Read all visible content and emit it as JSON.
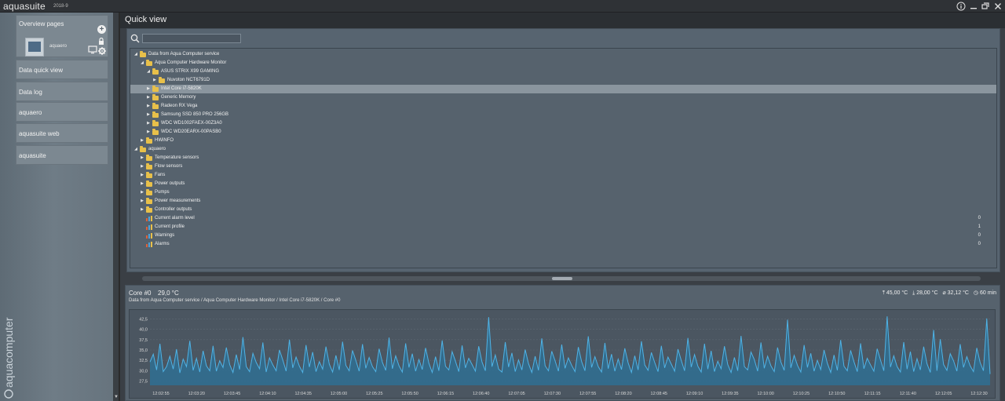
{
  "app": {
    "name": "aquasuite",
    "version": "2018-9",
    "brand_vertical": "aquacomputer",
    "window_controls": [
      "info-icon",
      "minimize-icon",
      "restore-icon",
      "close-icon"
    ]
  },
  "sidebar": {
    "overview": {
      "label": "Overview pages",
      "page_label": "aquaero"
    },
    "items": [
      {
        "label": "Data quick view"
      },
      {
        "label": "Data log"
      },
      {
        "label": "aquaero"
      },
      {
        "label": "aquasuite web"
      },
      {
        "label": "aquasuite"
      }
    ]
  },
  "main": {
    "title": "Quick view",
    "search": {
      "value": "",
      "placeholder": ""
    },
    "tree": [
      {
        "label": "Data from Aqua Computer service",
        "level": 0,
        "expanded": true,
        "icon": "folder"
      },
      {
        "label": "Aqua Computer Hardware Monitor",
        "level": 1,
        "expanded": true,
        "icon": "folder"
      },
      {
        "label": "ASUS STRIX X99 GAMING",
        "level": 2,
        "expanded": true,
        "icon": "folder"
      },
      {
        "label": "Nuvoton NCT6791D",
        "level": 3,
        "expanded": false,
        "icon": "folder"
      },
      {
        "label": "Intel Core i7-5820K",
        "level": 2,
        "expanded": false,
        "icon": "folder",
        "selected": true
      },
      {
        "label": "Generic Memory",
        "level": 2,
        "expanded": false,
        "icon": "folder"
      },
      {
        "label": "Radeon RX Vega",
        "level": 2,
        "expanded": false,
        "icon": "folder"
      },
      {
        "label": "Samsung SSD 850 PRO 256GB",
        "level": 2,
        "expanded": false,
        "icon": "folder"
      },
      {
        "label": "WDC WD1002FAEX-00Z3A0",
        "level": 2,
        "expanded": false,
        "icon": "folder"
      },
      {
        "label": "WDC WD20EARX-00PASB0",
        "level": 2,
        "expanded": false,
        "icon": "folder"
      },
      {
        "label": "HWiNFO",
        "level": 1,
        "expanded": false,
        "icon": "folder"
      },
      {
        "label": "aquaero",
        "level": 0,
        "expanded": true,
        "icon": "folder"
      },
      {
        "label": "Temperature sensors",
        "level": 1,
        "expanded": false,
        "icon": "folder"
      },
      {
        "label": "Flow sensors",
        "level": 1,
        "expanded": false,
        "icon": "folder"
      },
      {
        "label": "Fans",
        "level": 1,
        "expanded": false,
        "icon": "folder"
      },
      {
        "label": "Power outputs",
        "level": 1,
        "expanded": false,
        "icon": "folder"
      },
      {
        "label": "Pumps",
        "level": 1,
        "expanded": false,
        "icon": "folder"
      },
      {
        "label": "Power measurements",
        "level": 1,
        "expanded": false,
        "icon": "folder"
      },
      {
        "label": "Controller outputs",
        "level": 1,
        "expanded": false,
        "icon": "folder"
      },
      {
        "label": "Current alarm level",
        "level": 1,
        "icon": "bar-chart",
        "value": "0"
      },
      {
        "label": "Current profile",
        "level": 1,
        "icon": "bar-chart",
        "value": "1"
      },
      {
        "label": "Warnings",
        "level": 1,
        "icon": "bar-chart",
        "value": "0"
      },
      {
        "label": "Alarms",
        "level": 1,
        "icon": "bar-chart",
        "value": "0"
      }
    ]
  },
  "chart_panel": {
    "sensor_name": "Core #0",
    "current_value": "29,0 °C",
    "path": "Data from Aqua Computer service / Aqua Computer Hardware Monitor / Intel Core i7-5820K / Core #0",
    "stats": {
      "max": "45,00 °C",
      "min": "28,00 °C",
      "avg": "32,12 °C",
      "range": "60 min"
    }
  },
  "colors": {
    "line": "#4fb3e6",
    "fill": "#2f6f93",
    "folder": "#e8c04a",
    "selected_row": "#8a959e"
  },
  "chart_data": {
    "type": "area",
    "title": "Core #0",
    "xlabel": "",
    "ylabel": "",
    "ylim": [
      26.5,
      43.5
    ],
    "yticks": [
      "42,5",
      "40,0",
      "37,5",
      "35,0",
      "32,5",
      "30,0",
      "27,5"
    ],
    "ytick_values": [
      42.5,
      40.0,
      37.5,
      35.0,
      32.5,
      30.0,
      27.5
    ],
    "xticks": [
      "12:02:55",
      "12:03:20",
      "12:03:45",
      "12:04:10",
      "12:04:35",
      "12:05:00",
      "12:05:25",
      "12:05:50",
      "12:06:15",
      "12:06:40",
      "12:07:05",
      "12:07:30",
      "12:07:55",
      "12:08:20",
      "12:08:45",
      "12:09:10",
      "12:09:35",
      "12:10:00",
      "12:10:25",
      "12:10:50",
      "12:11:15",
      "12:11:40",
      "12:12:05",
      "12:12:30"
    ],
    "grid": true,
    "series": [
      {
        "values": [
          32.1,
          34.0,
          30.2,
          36.5,
          29.8,
          31.0,
          33.5,
          30.4,
          35.2,
          29.5,
          32.8,
          31.0,
          37.2,
          30.1,
          33.0,
          29.7,
          34.8,
          31.2,
          30.0,
          36.0,
          29.9,
          32.4,
          30.8,
          35.6,
          31.5,
          29.6,
          33.9,
          30.3,
          38.1,
          31.0,
          29.8,
          34.2,
          32.0,
          30.5,
          36.8,
          29.7,
          33.1,
          31.4,
          30.0,
          35.0,
          32.6,
          29.9,
          37.5,
          30.7,
          33.3,
          31.1,
          29.6,
          36.2,
          30.9,
          34.5,
          29.8,
          32.2,
          30.4,
          35.8,
          31.6,
          29.7,
          33.7,
          30.2,
          37.0,
          31.3,
          30.0,
          34.9,
          32.5,
          29.9,
          36.4,
          30.6,
          33.2,
          31.0,
          29.8,
          35.3,
          32.0,
          30.1,
          38.0,
          30.5,
          33.6,
          31.2,
          29.7,
          36.6,
          30.8,
          34.1,
          29.9,
          32.7,
          30.3,
          35.5,
          31.8,
          29.6,
          33.4,
          30.0,
          37.3,
          31.1,
          30.2,
          34.6,
          32.3,
          29.8,
          36.1,
          30.7,
          33.0,
          31.5,
          29.9,
          35.9,
          32.1,
          30.0,
          42.9,
          31.0,
          33.8,
          30.4,
          29.7,
          36.9,
          30.9,
          34.3,
          29.8,
          32.6,
          30.2,
          35.1,
          31.7,
          29.6,
          33.5,
          30.1,
          37.8,
          31.2,
          30.0,
          34.7,
          32.4,
          29.9,
          36.3,
          30.6,
          33.1,
          31.3,
          29.8,
          35.7,
          32.2,
          30.0,
          38.3,
          30.8,
          33.4,
          31.0,
          29.7,
          36.7,
          30.5,
          34.0,
          29.9,
          32.8,
          30.3,
          35.4,
          31.9,
          29.6,
          33.6,
          30.2,
          37.1,
          31.4,
          30.1,
          34.4,
          32.0,
          29.8,
          36.0,
          30.7,
          33.3,
          31.6,
          29.9,
          35.2,
          32.5,
          30.0,
          37.9,
          30.9,
          33.9,
          31.1,
          29.7,
          36.5,
          30.4,
          34.8,
          29.8,
          32.3,
          30.5,
          35.9,
          31.5,
          29.6,
          33.2,
          30.0,
          38.4,
          31.0,
          30.2,
          34.5,
          32.7,
          29.9,
          36.8,
          30.6,
          33.5,
          31.2,
          29.8,
          35.6,
          32.1,
          30.1,
          42.3,
          30.7,
          33.7,
          31.3,
          29.7,
          36.2,
          30.8,
          34.2,
          29.9,
          32.5,
          30.3,
          35.0,
          31.8,
          29.6,
          33.8,
          30.1,
          37.4,
          31.1,
          30.0,
          34.9,
          32.2,
          29.8,
          36.6,
          30.5,
          33.0,
          31.4,
          29.9,
          35.3,
          32.6,
          30.0,
          43.1,
          30.9,
          33.6,
          31.0,
          29.7,
          36.9,
          30.4,
          34.6,
          29.8,
          32.9,
          30.2,
          35.8,
          31.7,
          29.6,
          39.8,
          30.0,
          37.6,
          31.5,
          30.1,
          34.1,
          32.4,
          29.9,
          36.4,
          30.8,
          33.4,
          31.2,
          29.8,
          35.5,
          32.0,
          30.0,
          42.6,
          29.2
        ]
      }
    ]
  }
}
